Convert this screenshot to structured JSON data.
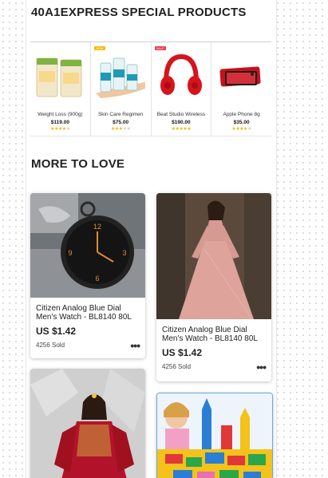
{
  "special": {
    "title": "40A1EXPRESS SPECIAL PRODUCTS",
    "items": [
      {
        "name": "Weight Loss (900g)",
        "price": "$119.00",
        "rating": 4,
        "tag": ""
      },
      {
        "name": "Skin Care Regimen",
        "price": "$75.00",
        "rating": 3,
        "tag": "NEW",
        "tag_color": "#f6b800"
      },
      {
        "name": "Beat Studio Wireless",
        "price": "$190.00",
        "rating": 5,
        "tag": "SALE",
        "tag_color": "#e8394a"
      },
      {
        "name": "Apple Phone 8g",
        "price": "$35.00",
        "rating": 4,
        "tag": ""
      }
    ]
  },
  "more": {
    "title": "MORE TO LOVE",
    "cards": [
      {
        "title": "Citizen Analog Blue Dial Men's Watch - BL8140 80L",
        "price": "US $1.42",
        "sold": "4256 Sold",
        "image": "pocket-watch"
      },
      {
        "title": "Citizen Analog Blue Dial Men's Watch - BL8140 80L",
        "price": "US $1.42",
        "sold": "4256 Sold",
        "image": "pink-gown"
      },
      {
        "image": "red-bridal-dress"
      },
      {
        "image": "building-blocks"
      }
    ]
  },
  "colors": {
    "star": "#f5b400",
    "accent_sale": "#e8394a",
    "accent_new": "#f6b800"
  }
}
